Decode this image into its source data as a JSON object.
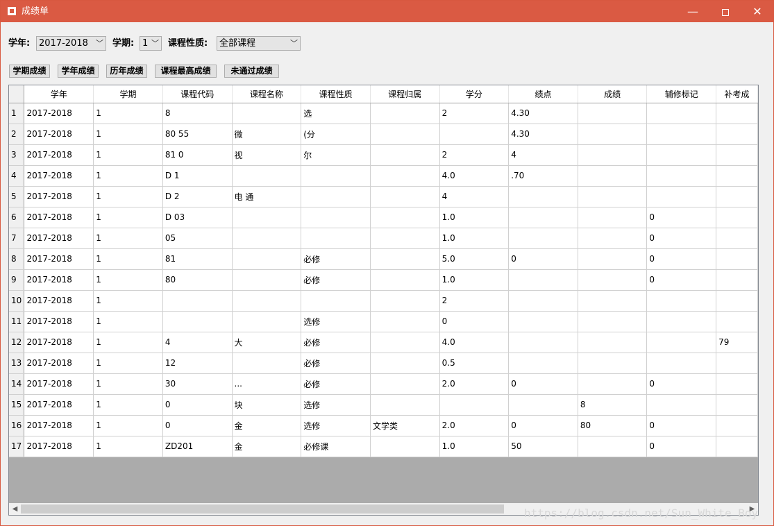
{
  "window": {
    "title": "成绩单",
    "minimize": "—",
    "close": "✕"
  },
  "filters": {
    "year_label": "学年:",
    "year_value": "2017-2018",
    "term_label": "学期:",
    "term_value": "1",
    "nature_label": "课程性质:",
    "nature_value": "全部课程"
  },
  "actions": {
    "term_grades": "学期成绩",
    "year_grades": "学年成绩",
    "history_grades": "历年成绩",
    "highest_grades": "课程最高成绩",
    "failed_grades": "未通过成绩"
  },
  "table": {
    "columns": [
      "学年",
      "学期",
      "课程代码",
      "课程名称",
      "课程性质",
      "课程归属",
      "学分",
      "绩点",
      "成绩",
      "辅修标记",
      "补考成"
    ],
    "rows": [
      [
        "1",
        "2017-2018",
        "1",
        "8",
        "",
        "选",
        "",
        "2",
        "4.30",
        "",
        "",
        ""
      ],
      [
        "2",
        "2017-2018",
        "1",
        "80 55",
        "微",
        "(分",
        "",
        "",
        "4.30",
        "",
        "",
        ""
      ],
      [
        "3",
        "2017-2018",
        "1",
        "81 0",
        "视",
        "尔",
        "",
        "2",
        "4",
        "",
        "",
        ""
      ],
      [
        "4",
        "2017-2018",
        "1",
        "D 1",
        "",
        "",
        "",
        "4.0",
        ".70",
        "",
        "",
        ""
      ],
      [
        "5",
        "2017-2018",
        "1",
        "D 2",
        "电 通",
        "",
        "",
        "4",
        "",
        "",
        "",
        ""
      ],
      [
        "6",
        "2017-2018",
        "1",
        "D 03",
        "",
        "",
        "",
        "1.0",
        "",
        "",
        "0",
        ""
      ],
      [
        "7",
        "2017-2018",
        "1",
        "05",
        "",
        "",
        "",
        "1.0",
        "",
        "",
        "0",
        ""
      ],
      [
        "8",
        "2017-2018",
        "1",
        "81",
        "",
        "必修",
        "",
        "5.0",
        "0",
        "",
        "0",
        ""
      ],
      [
        "9",
        "2017-2018",
        "1",
        "80",
        "",
        "必修",
        "",
        "1.0",
        "",
        "",
        "0",
        ""
      ],
      [
        "10",
        "2017-2018",
        "1",
        "",
        "",
        "",
        "",
        "2",
        "",
        "",
        "",
        ""
      ],
      [
        "11",
        "2017-2018",
        "1",
        "",
        "",
        "选修",
        "",
        "0",
        "",
        "",
        "",
        ""
      ],
      [
        "12",
        "2017-2018",
        "1",
        "4",
        "大",
        "必修",
        "",
        "4.0",
        "",
        "",
        "",
        "79"
      ],
      [
        "13",
        "2017-2018",
        "1",
        "12",
        "",
        "必修",
        "",
        "0.5",
        "",
        "",
        "",
        ""
      ],
      [
        "14",
        "2017-2018",
        "1",
        "30",
        "...",
        "必修",
        "",
        "2.0",
        "0",
        "",
        "0",
        ""
      ],
      [
        "15",
        "2017-2018",
        "1",
        "0",
        "块",
        "选修",
        "",
        "",
        "",
        "8",
        "",
        ""
      ],
      [
        "16",
        "2017-2018",
        "1",
        "0",
        "金",
        "选修",
        "文学类",
        "2.0",
        "0",
        "80",
        "0",
        ""
      ],
      [
        "17",
        "2017-2018",
        "1",
        "ZD201",
        "金",
        "必修课",
        "",
        "1.0",
        "50",
        "",
        "0",
        ""
      ]
    ]
  },
  "watermark": "https://blog.csdn.net/Sun_White_Boy"
}
